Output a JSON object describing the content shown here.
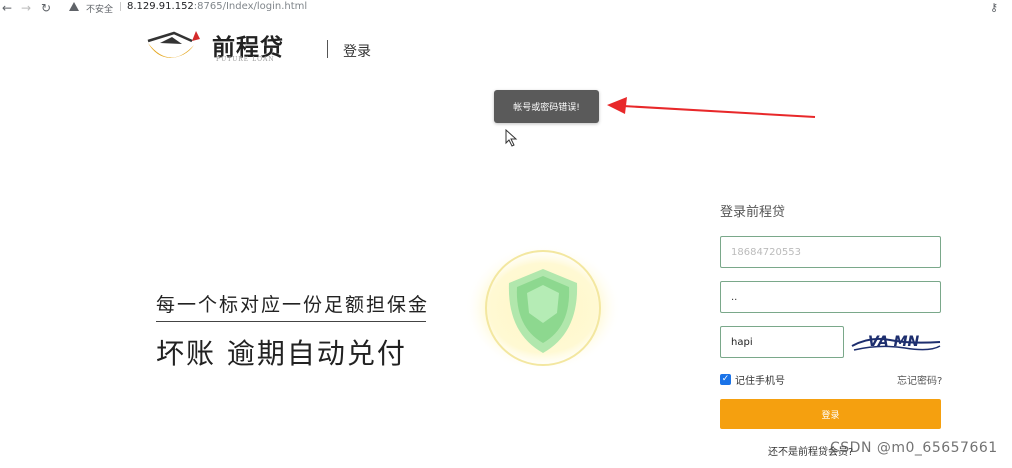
{
  "browser": {
    "back_icon": "arrow-left-icon",
    "forward_icon": "arrow-right-icon",
    "reload_icon": "reload-icon",
    "warning_icon": "warning-icon",
    "insecure_label": "不安全",
    "separator": "|",
    "url_host": "8.129.91.152",
    "url_rest": ":8765/Index/login.html",
    "key_icon": "key-icon"
  },
  "header": {
    "logo_title": "前程贷",
    "logo_subtitle": "FUTURE LOAN",
    "login_label": "登录"
  },
  "toast": {
    "message": "帐号或密码错误!"
  },
  "hero": {
    "line1": "每一个标对应一份足额担保金",
    "line2": "坏账  逾期自动兑付"
  },
  "form": {
    "title": "登录前程贷",
    "phone_value": "18684720553",
    "password_value": "..",
    "captcha_value": "hapi",
    "captcha_image_text": "VA MN",
    "remember_label": "记住手机号",
    "forgot_label": "忘记密码?",
    "submit_label": "登录",
    "footer_text": "还不是前程贷会员?"
  },
  "watermark": "CSDN @m0_65657661",
  "colors": {
    "accent_orange": "#f5a00f",
    "toast_bg": "#5a5a5a",
    "arrow_red": "#e8282a",
    "input_border": "#7aa88a",
    "logo_gold": "#e5a823"
  }
}
